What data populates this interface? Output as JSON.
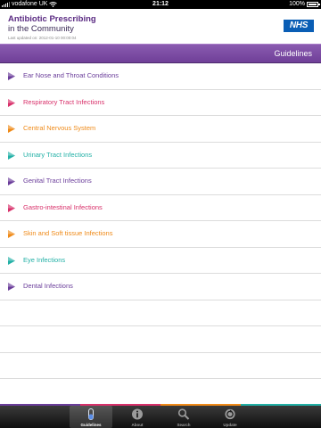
{
  "status_bar": {
    "carrier": "vodafone UK",
    "time": "21:12",
    "battery": "100%",
    "battery_level": 1.0
  },
  "header": {
    "title_line1": "Antibiotic Prescribing",
    "title_line2": "in the Community",
    "last_updated": "Last updated on: 2012-01-10 00:00:04",
    "logo": "NHS"
  },
  "title_bar": {
    "title": "Guidelines"
  },
  "guidelines": [
    {
      "label": "Ear Nose and Throat Conditions",
      "color": "#6a3d9a"
    },
    {
      "label": "Respiratory Tract Infections",
      "color": "#d8306a"
    },
    {
      "label": "Central Nervous System",
      "color": "#ef8a18"
    },
    {
      "label": "Urinary Tract Infections",
      "color": "#22b0a6"
    },
    {
      "label": "Genital Tract Infections",
      "color": "#6a3d9a"
    },
    {
      "label": "Gastro-intestinal Infections",
      "color": "#d8306a"
    },
    {
      "label": "Skin and Soft tissue Infections",
      "color": "#ef8a18"
    },
    {
      "label": "Eye Infections",
      "color": "#22b0a6"
    },
    {
      "label": "Dental Infections",
      "color": "#6a3d9a"
    }
  ],
  "stripe_colors": [
    "#6a3d9a",
    "#d8306a",
    "#ef8a18",
    "#22b0a6"
  ],
  "tabs": [
    {
      "label": "Guidelines",
      "icon": "pill-icon",
      "active": true
    },
    {
      "label": "About",
      "icon": "info-icon",
      "active": false
    },
    {
      "label": "Search",
      "icon": "magnifier-icon",
      "active": false
    },
    {
      "label": "Update",
      "icon": "update-icon",
      "active": false
    }
  ]
}
